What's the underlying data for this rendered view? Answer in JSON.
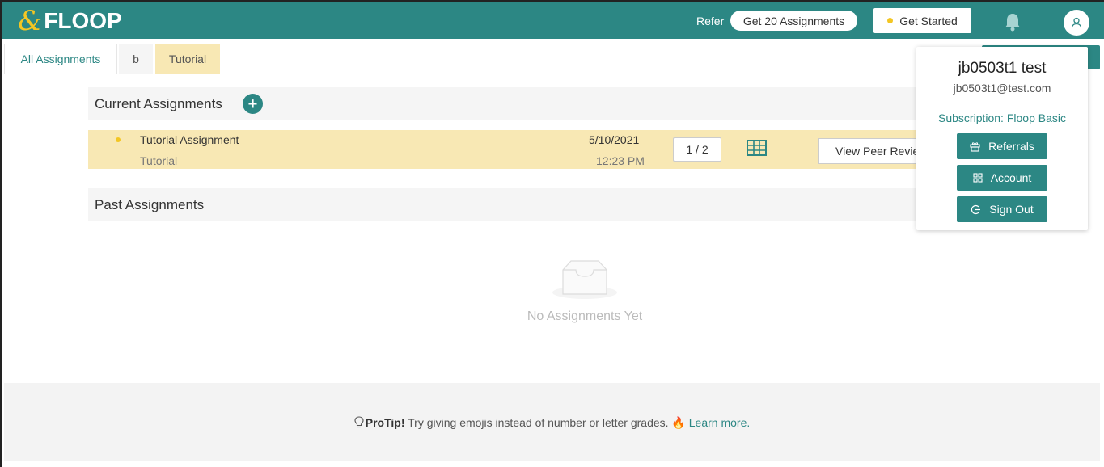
{
  "header": {
    "logo_text": "FLOOP",
    "refer_label": "Refer",
    "refer_button": "Get 20 Assignments",
    "get_started": "Get Started",
    "icons": [
      "bell-icon",
      "user-icon"
    ]
  },
  "tabs": [
    {
      "label": "All Assignments",
      "active": true
    },
    {
      "label": "b",
      "active": false
    },
    {
      "label": "Tutorial",
      "active": false
    }
  ],
  "current": {
    "title": "Current Assignments",
    "add_label": "+",
    "rows": [
      {
        "title": "Tutorial Assignment",
        "course": "Tutorial",
        "date": "5/10/2021",
        "time": "12:23 PM",
        "count": "1 / 2",
        "peer_button": "View Peer Review"
      }
    ]
  },
  "past": {
    "title": "Past Assignments",
    "empty_text": "No Assignments Yet"
  },
  "footer": {
    "protip_label": "ProTip!",
    "protip_text": " Try giving emojis instead of number or letter grades. 🔥 ",
    "learn_more": "Learn more."
  },
  "dropdown": {
    "name": "jb0503t1 test",
    "email": "jb0503t1@test.com",
    "subscription": "Subscription: Floop Basic",
    "buttons": {
      "referrals": "Referrals",
      "account": "Account",
      "sign_out": "Sign Out"
    }
  },
  "colors": {
    "brand": "#2c8784",
    "accent": "#f3c623",
    "highlight": "#f8e8b4"
  }
}
